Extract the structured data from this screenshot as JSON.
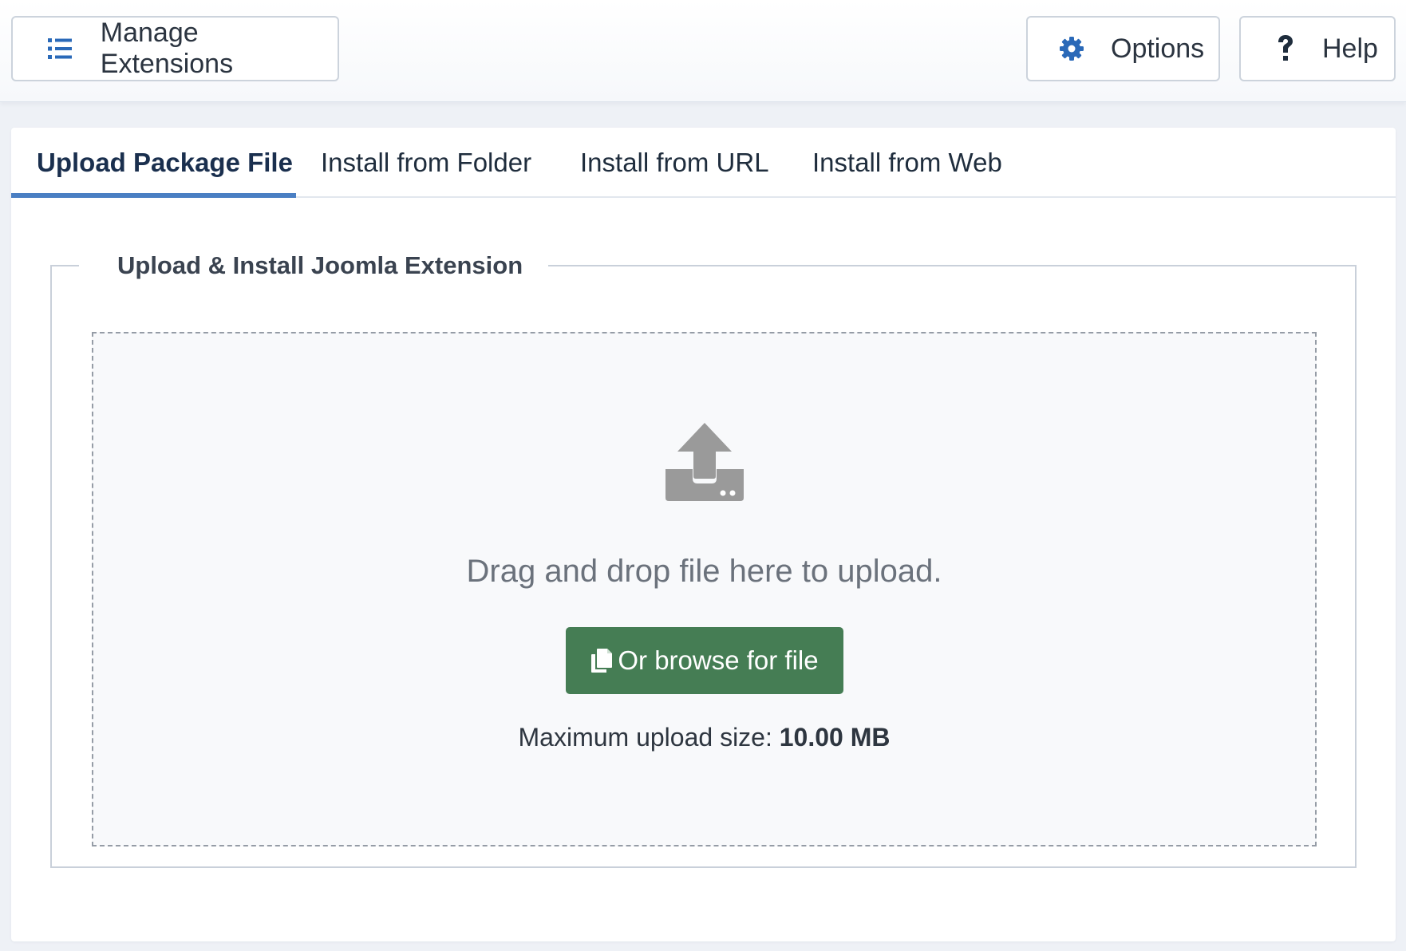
{
  "toolbar": {
    "manage_label": "Manage Extensions",
    "manage_icon": "list-icon",
    "options_label": "Options",
    "options_icon": "gear-icon",
    "help_label": "Help",
    "help_icon": "question-icon"
  },
  "tabs": [
    {
      "label": "Upload Package File",
      "active": true
    },
    {
      "label": "Install from Folder",
      "active": false
    },
    {
      "label": "Install from URL",
      "active": false
    },
    {
      "label": "Install from Web",
      "active": false
    }
  ],
  "upload": {
    "legend": "Upload & Install Joomla Extension",
    "icon": "upload-icon",
    "drag_text": "Drag and drop file here to upload.",
    "browse_label": "Or browse for file",
    "browse_icon": "copy-icon",
    "max_label": "Maximum upload size:",
    "max_value": "10.00 MB"
  },
  "colors": {
    "accent": "#2a69b8",
    "active_tab_underline": "#4a7fc3",
    "browse_button": "#457d54",
    "upload_icon": "#9a9a9a"
  }
}
